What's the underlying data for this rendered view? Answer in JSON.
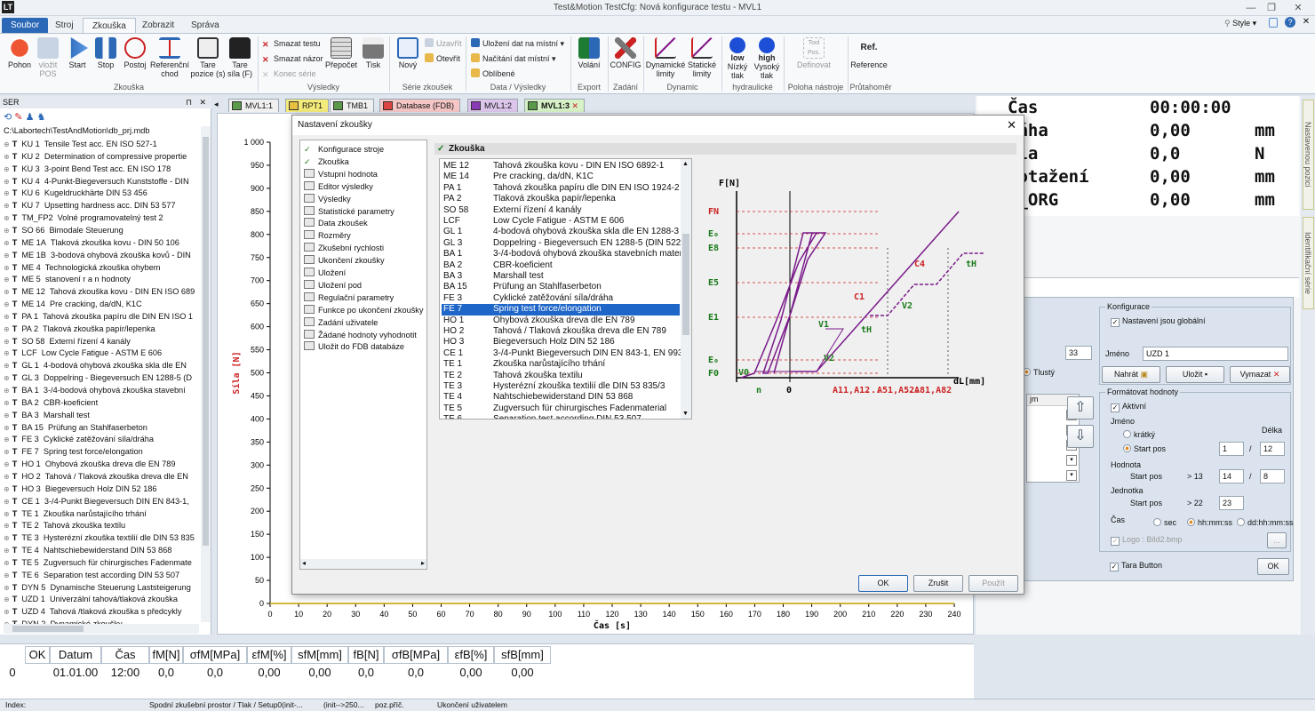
{
  "window": {
    "title": "Test&Motion   TestCfg: Nová konfigurace testu -  MVL1",
    "style_label": "Style"
  },
  "ribbon_tabs": [
    "Soubor",
    "Stroj",
    "Zkouška",
    "Zobrazit",
    "Správa"
  ],
  "ribbon": {
    "zkouska_group": [
      "Pohon",
      "vložit POS",
      "Start",
      "Stop",
      "Postoj",
      "Referenční chod",
      "Tare pozice (s)",
      "Tare síla (F)"
    ],
    "vysledky_small": [
      "Smazat testu",
      "Smazat názor",
      "Konec série"
    ],
    "vysledky_big": [
      "Přepočet",
      "Tisk"
    ],
    "serie_big": [
      "Nový"
    ],
    "serie_small": [
      "Uzavřít",
      "Otevřít"
    ],
    "data_small": [
      "Uložení dat na místní",
      "Načítání dat místní",
      "Oblíbené"
    ],
    "export": [
      "Volání"
    ],
    "zadani": [
      "CONFIG"
    ],
    "dynamic": [
      "Dynamické limity",
      "Statické limity"
    ],
    "hydraulic": [
      "Nízký tlak",
      "Vysoký tlak"
    ],
    "tool": [
      "Definovat"
    ],
    "extenso": [
      "Reference"
    ],
    "icon_texts": {
      "low": "low",
      "high": "high",
      "ref": "Ref.",
      "tool": "Tool Pos."
    },
    "groups": [
      "Zkouška",
      "Výsledky",
      "Série zkoušek",
      "Data / Výsledky",
      "Export",
      "Zadání",
      "Dynamic",
      "hydraulické",
      "Poloha nástroje",
      "Průtahoměr"
    ]
  },
  "left_panel": {
    "title": "SER",
    "path": "C:\\Labortech\\TestAndMotion\\db_prj.mdb",
    "items": [
      [
        "KU 1",
        "Tensile Test acc. EN ISO 527-1"
      ],
      [
        "KU 2",
        "Determination of compressive propertie"
      ],
      [
        "KU 3",
        "3-point Bend Test acc. EN ISO 178"
      ],
      [
        "KU 4",
        "4-Punkt-Biegeversuch Kunststoffe - DIN"
      ],
      [
        "KU 6",
        "Kugeldruckhärte DIN 53 456"
      ],
      [
        "KU 7",
        "Upsetting hardness acc. DIN 53 577"
      ],
      [
        "TM_FP2",
        "Volné programovatelný test 2"
      ],
      [
        "SO 66",
        "Bimodale Steuerung"
      ],
      [
        "ME 1A",
        "Tlaková zkouška kovu - DIN 50 106"
      ],
      [
        "ME 1B",
        "3-bodová ohybová zkouška kovů - DIN"
      ],
      [
        "ME 4",
        "Technologická zkouška ohybem"
      ],
      [
        "ME 5",
        "stanovení r a n hodnoty"
      ],
      [
        "ME 12",
        "Tahová zkouška kovu - DIN EN ISO 689"
      ],
      [
        "ME 14",
        "Pre cracking, da/dN, K1C"
      ],
      [
        "PA 1",
        "Tahová zkouška papíru dle DIN EN ISO 1"
      ],
      [
        "PA 2",
        "Tlaková zkouška papír/lepenka"
      ],
      [
        "SO 58",
        "Externí řízení 4 kanály"
      ],
      [
        "LCF",
        "Low Cycle Fatigue - ASTM E 606"
      ],
      [
        "GL 1",
        "4-bodová ohybová zkouška skla dle  EN"
      ],
      [
        "GL 3",
        "Doppelring - Biegeversuch EN 1288-5 (D"
      ],
      [
        "BA 1",
        "3-/4-bodová ohybová zkouška stavební"
      ],
      [
        "BA 2",
        "CBR-koeficient"
      ],
      [
        "BA 3",
        "Marshall test"
      ],
      [
        "BA 15",
        "Prüfung an Stahlfaserbeton"
      ],
      [
        "FE 3",
        "Cyklické zatěžování síla/dráha"
      ],
      [
        "FE 7",
        "Spring test force/elongation"
      ],
      [
        "HO 1",
        "Ohybová zkouška dreva dle EN 789"
      ],
      [
        "HO 2",
        "Tahová / Tlaková zkouška dreva dle EN"
      ],
      [
        "HO 3",
        "Biegeversuch Holz  DIN 52 186"
      ],
      [
        "CE 1",
        "3-/4-Punkt Biegeversuch DIN EN 843-1,"
      ],
      [
        "TE 1",
        "Zkouška narůstajícího trhání"
      ],
      [
        "TE 2",
        "Tahová zkouška textilu"
      ],
      [
        "TE 3",
        "Hysterézní zkouška textilií dle DIN 53 835"
      ],
      [
        "TE 4",
        "Nahtschiebewiderstand DIN 53 868"
      ],
      [
        "TE 5",
        "Zugversuch für chirurgisches Fadenmate"
      ],
      [
        "TE 6",
        "Separation test according DIN 53 507"
      ],
      [
        "DYN 5",
        "Dynamische Steuerung Laststeigerung"
      ],
      [
        "UZD 1",
        "Univerzální tahová/tlaková zkouška"
      ],
      [
        "UZD 4",
        "Tahová /tlaková zkouška s předcykly"
      ],
      [
        "DYN 2",
        "Dynamické zkoušky"
      ]
    ]
  },
  "doc_tabs": [
    "MVL1:1",
    "RPT1",
    "TMB1",
    "Database (FDB)",
    "MVL1:2",
    "MVL1:3"
  ],
  "chart_data": {
    "type": "line",
    "title": "",
    "xlabel": "Čas [s]",
    "ylabel": "Síla [N]",
    "xlim": [
      0,
      240
    ],
    "ylim": [
      0,
      1000
    ],
    "x_ticks": [
      0,
      10,
      20,
      30,
      40,
      50,
      60,
      70,
      80,
      90,
      100,
      110,
      120,
      130,
      140,
      150,
      160,
      170,
      180,
      190,
      200,
      210,
      220,
      230,
      240
    ],
    "y_ticks": [
      0,
      50,
      100,
      150,
      200,
      250,
      300,
      350,
      400,
      450,
      500,
      550,
      600,
      650,
      700,
      750,
      800,
      850,
      900,
      950,
      1000
    ],
    "y_tick_labels": [
      "0",
      "50",
      "100",
      "150",
      "200",
      "250",
      "300",
      "350",
      "400",
      "450",
      "500",
      "550",
      "600",
      "650",
      "700",
      "750",
      "800",
      "850",
      "900",
      "950",
      "1 000"
    ],
    "series": [
      {
        "x": [
          0,
          240
        ],
        "y": [
          0,
          0
        ]
      }
    ]
  },
  "readout": [
    {
      "label": "Čas",
      "value": "00:00:00",
      "unit": ""
    },
    {
      "label": "ráha",
      "value": "0,00",
      "unit": "mm"
    },
    {
      "label": "íla",
      "value": "0,0",
      "unit": "N"
    },
    {
      "label": "rotažení",
      "value": "0,00",
      "unit": "mm"
    },
    {
      "label": "L_ORG",
      "value": "0,00",
      "unit": "mm"
    }
  ],
  "vtabs": [
    "Nastavenou pozici",
    "Identifikační série"
  ],
  "config_panel": {
    "group_title": "Konfigurace",
    "global_settings": "Nastavení jsou globální",
    "name_label": "Jméno",
    "name_value": "UZD 1",
    "save_buttons": [
      "Nahrát",
      "Uložit",
      "Vymazat"
    ],
    "left_value": "33",
    "bold_label": "Tlustý",
    "format_title": "Formátovat hodnoty",
    "active": "Aktivní",
    "jmeno": "Jméno",
    "delka": "Délka",
    "kratky": "krátký",
    "start_pos": "Start pos",
    "hodnota": "Hodnota",
    "jednotka": "Jednotka",
    "cas": "Čas",
    "time_options": [
      "sec",
      "hh:mm:ss",
      "dd:hh:mm:ss"
    ],
    "row1": [
      "1",
      "12"
    ],
    "row2_prefix": "> 13",
    "row2": [
      "14",
      "8"
    ],
    "row3_prefix": "> 22",
    "row3": [
      "23"
    ],
    "logo": "Logo : Bild2.bmp",
    "logo_btn": "...",
    "tara": "Tara Button",
    "ok": "OK",
    "combo_header": "jm"
  },
  "results_table": {
    "headers": [
      "OK",
      "Datum",
      "Čas",
      "fM[N]",
      "σfM[MPa]",
      "εfM[%]",
      "sfM[mm]",
      "fB[N]",
      "σfB[MPa]",
      "εfB[%]",
      "sfB[mm]"
    ],
    "row_index": "0",
    "row": [
      "",
      "01.01.00",
      "12:00",
      "0,0",
      "0,0",
      "0,00",
      "0,00",
      "0,0",
      "0,0",
      "0,00",
      "0,00"
    ]
  },
  "status_bar": [
    "Index:",
    "Spodní zkušební prostor / Tlak / Setup0(init-...",
    "(init-->250...",
    "poz.příč.",
    "Ukončení uživatelem"
  ],
  "dialog": {
    "title": "Nastavení zkoušky",
    "nav": [
      "Konfigurace stroje",
      "Zkouška",
      "Vstupní hodnota",
      "Editor výsledky",
      "Výsledky",
      "Statistické parametry",
      "Data zkoušek",
      "Rozměry",
      "Zkušební rychlosti",
      "Ukončení zkoušky",
      "Uložení",
      "Uložení pod",
      "Regulační parametry",
      "Funkce po ukončení zkoušky",
      "Zadání uživatele",
      "Žádané hodnoty vyhodnotit",
      "Uložit do FDB databáze"
    ],
    "section": "Zkouška",
    "selected_code": "FE 7",
    "tests": [
      [
        "ME 12",
        "Tahová zkouška kovu - DIN EN ISO 6892-1"
      ],
      [
        "ME 14",
        "Pre cracking, da/dN, K1C"
      ],
      [
        "PA 1",
        "Tahová zkouška papíru dle DIN EN ISO 1924-2"
      ],
      [
        "PA 2",
        "Tlaková zkouška papír/lepenka"
      ],
      [
        "SO 58",
        "Externí řízení 4 kanály"
      ],
      [
        "LCF",
        "Low Cycle Fatigue - ASTM E 606"
      ],
      [
        "GL 1",
        "4-bodová ohybová zkouška skla dle  EN 1288-3"
      ],
      [
        "GL 3",
        "Doppelring - Biegeversuch EN 1288-5 (DIN 5229"
      ],
      [
        "BA 1",
        "3-/4-bodová ohybová zkouška stavebních mater"
      ],
      [
        "BA 2",
        "CBR-koeficient"
      ],
      [
        "BA 3",
        "Marshall test"
      ],
      [
        "BA 15",
        "Prüfung an Stahlfaserbeton"
      ],
      [
        "FE 3",
        "Cyklické zatěžování síla/dráha"
      ],
      [
        "FE 7",
        "Spring test force/elongation"
      ],
      [
        "HO 1",
        "Ohybová zkouška dreva dle EN 789"
      ],
      [
        "HO 2",
        "Tahová / Tlaková zkouška dreva dle EN 789"
      ],
      [
        "HO 3",
        "Biegeversuch Holz  DIN 52 186"
      ],
      [
        "CE 1",
        "3-/4-Punkt Biegeversuch DIN EN 843-1, EN 993"
      ],
      [
        "TE 1",
        "Zkouška narůstajícího trhání"
      ],
      [
        "TE 2",
        "Tahová zkouška textilu"
      ],
      [
        "TE 3",
        "Hysterézní zkouška textilií dle DIN 53 835/3"
      ],
      [
        "TE 4",
        "Nahtschiebewiderstand DIN 53 868"
      ],
      [
        "TE 5",
        "Zugversuch für chirurgisches Fadenmaterial"
      ],
      [
        "TE 6",
        "Separation test according DIN 53 507"
      ]
    ],
    "diagram_labels": {
      "y": "F[N]",
      "x": "dL[mm]",
      "FN": "FN",
      "E0": "E₀",
      "E8": "E8",
      "E5": "E5",
      "E1": "E1",
      "Ez": "E₀",
      "F0": "F0",
      "V0": "V0",
      "V1": "V1",
      "V2a": "V2",
      "V2b": "V2",
      "C1": "C1",
      "C4": "C4",
      "tH1": "tH",
      "tH2": "tH",
      "n": "n",
      "zero": "0",
      "a1": "A11,A12",
      "a2": "A51,A52",
      "a3": "A81,A82",
      "dots1": "...",
      "dots2": "..."
    },
    "buttons": [
      "OK",
      "Zrušit",
      "Použít"
    ]
  }
}
